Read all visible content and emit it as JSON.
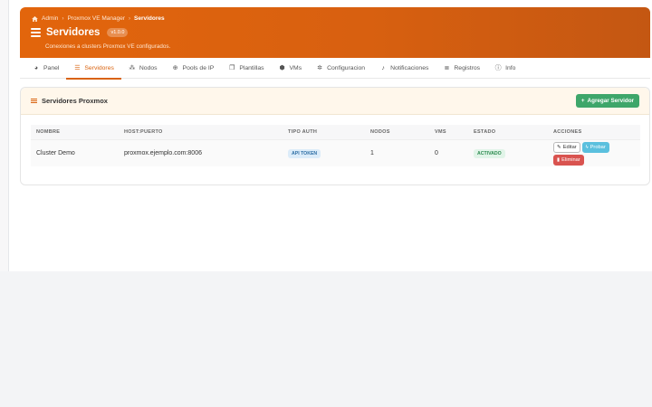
{
  "breadcrumb": {
    "admin": "Admin",
    "manager": "Proxmox VE Manager",
    "current": "Servidores"
  },
  "header": {
    "title": "Servidores",
    "version": "v1.0.0",
    "subtitle": "Conexiones a clusters Proxmox VE configurados."
  },
  "tabs": [
    {
      "label": "Panel",
      "icon": "dashboard-icon",
      "active": false
    },
    {
      "label": "Servidores",
      "icon": "server-icon",
      "active": true
    },
    {
      "label": "Nodos",
      "icon": "nodes-icon",
      "active": false
    },
    {
      "label": "Pools de IP",
      "icon": "globe-icon",
      "active": false
    },
    {
      "label": "Plantillas",
      "icon": "templates-icon",
      "active": false
    },
    {
      "label": "VMs",
      "icon": "cube-icon",
      "active": false
    },
    {
      "label": "Configuracion",
      "icon": "gear-icon",
      "active": false
    },
    {
      "label": "Notificaciones",
      "icon": "bell-icon",
      "active": false
    },
    {
      "label": "Registros",
      "icon": "list-icon",
      "active": false
    },
    {
      "label": "Info",
      "icon": "info-icon",
      "active": false
    }
  ],
  "card": {
    "title": "Servidores Proxmox",
    "add_label": "Agregar Servidor"
  },
  "table": {
    "columns": [
      "NOMBRE",
      "HOST:PUERTO",
      "TIPO AUTH",
      "NODOS",
      "VMS",
      "ESTADO",
      "ACCIONES"
    ],
    "rows": [
      {
        "name": "Cluster Demo",
        "host": "proxmox.ejemplo.com:8006",
        "auth": "API TOKEN",
        "nodes": "1",
        "vms": "0",
        "status": "ACTIVADO"
      }
    ],
    "actions": {
      "edit": "Editar",
      "test": "Probar",
      "delete": "Eliminar"
    }
  },
  "colors": {
    "brand": "#d9620e",
    "success": "#3ea66a",
    "info": "#5bc0de",
    "danger": "#d9534f"
  }
}
